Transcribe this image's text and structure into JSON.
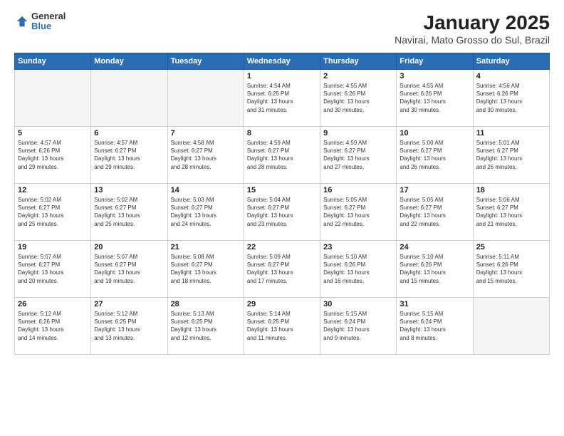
{
  "logo": {
    "general": "General",
    "blue": "Blue"
  },
  "title": "January 2025",
  "subtitle": "Navirai, Mato Grosso do Sul, Brazil",
  "days_of_week": [
    "Sunday",
    "Monday",
    "Tuesday",
    "Wednesday",
    "Thursday",
    "Friday",
    "Saturday"
  ],
  "weeks": [
    [
      {
        "day": "",
        "info": ""
      },
      {
        "day": "",
        "info": ""
      },
      {
        "day": "",
        "info": ""
      },
      {
        "day": "1",
        "info": "Sunrise: 4:54 AM\nSunset: 6:25 PM\nDaylight: 13 hours\nand 31 minutes."
      },
      {
        "day": "2",
        "info": "Sunrise: 4:55 AM\nSunset: 6:26 PM\nDaylight: 13 hours\nand 30 minutes."
      },
      {
        "day": "3",
        "info": "Sunrise: 4:55 AM\nSunset: 6:26 PM\nDaylight: 13 hours\nand 30 minutes."
      },
      {
        "day": "4",
        "info": "Sunrise: 4:56 AM\nSunset: 6:26 PM\nDaylight: 13 hours\nand 30 minutes."
      }
    ],
    [
      {
        "day": "5",
        "info": "Sunrise: 4:57 AM\nSunset: 6:26 PM\nDaylight: 13 hours\nand 29 minutes."
      },
      {
        "day": "6",
        "info": "Sunrise: 4:57 AM\nSunset: 6:27 PM\nDaylight: 13 hours\nand 29 minutes."
      },
      {
        "day": "7",
        "info": "Sunrise: 4:58 AM\nSunset: 6:27 PM\nDaylight: 13 hours\nand 28 minutes."
      },
      {
        "day": "8",
        "info": "Sunrise: 4:59 AM\nSunset: 6:27 PM\nDaylight: 13 hours\nand 28 minutes."
      },
      {
        "day": "9",
        "info": "Sunrise: 4:59 AM\nSunset: 6:27 PM\nDaylight: 13 hours\nand 27 minutes."
      },
      {
        "day": "10",
        "info": "Sunrise: 5:00 AM\nSunset: 6:27 PM\nDaylight: 13 hours\nand 26 minutes."
      },
      {
        "day": "11",
        "info": "Sunrise: 5:01 AM\nSunset: 6:27 PM\nDaylight: 13 hours\nand 26 minutes."
      }
    ],
    [
      {
        "day": "12",
        "info": "Sunrise: 5:02 AM\nSunset: 6:27 PM\nDaylight: 13 hours\nand 25 minutes."
      },
      {
        "day": "13",
        "info": "Sunrise: 5:02 AM\nSunset: 6:27 PM\nDaylight: 13 hours\nand 25 minutes."
      },
      {
        "day": "14",
        "info": "Sunrise: 5:03 AM\nSunset: 6:27 PM\nDaylight: 13 hours\nand 24 minutes."
      },
      {
        "day": "15",
        "info": "Sunrise: 5:04 AM\nSunset: 6:27 PM\nDaylight: 13 hours\nand 23 minutes."
      },
      {
        "day": "16",
        "info": "Sunrise: 5:05 AM\nSunset: 6:27 PM\nDaylight: 13 hours\nand 22 minutes."
      },
      {
        "day": "17",
        "info": "Sunrise: 5:05 AM\nSunset: 6:27 PM\nDaylight: 13 hours\nand 22 minutes."
      },
      {
        "day": "18",
        "info": "Sunrise: 5:06 AM\nSunset: 6:27 PM\nDaylight: 13 hours\nand 21 minutes."
      }
    ],
    [
      {
        "day": "19",
        "info": "Sunrise: 5:07 AM\nSunset: 6:27 PM\nDaylight: 13 hours\nand 20 minutes."
      },
      {
        "day": "20",
        "info": "Sunrise: 5:07 AM\nSunset: 6:27 PM\nDaylight: 13 hours\nand 19 minutes."
      },
      {
        "day": "21",
        "info": "Sunrise: 5:08 AM\nSunset: 6:27 PM\nDaylight: 13 hours\nand 18 minutes."
      },
      {
        "day": "22",
        "info": "Sunrise: 5:09 AM\nSunset: 6:27 PM\nDaylight: 13 hours\nand 17 minutes."
      },
      {
        "day": "23",
        "info": "Sunrise: 5:10 AM\nSunset: 6:26 PM\nDaylight: 13 hours\nand 16 minutes."
      },
      {
        "day": "24",
        "info": "Sunrise: 5:10 AM\nSunset: 6:26 PM\nDaylight: 13 hours\nand 15 minutes."
      },
      {
        "day": "25",
        "info": "Sunrise: 5:11 AM\nSunset: 6:26 PM\nDaylight: 13 hours\nand 15 minutes."
      }
    ],
    [
      {
        "day": "26",
        "info": "Sunrise: 5:12 AM\nSunset: 6:26 PM\nDaylight: 13 hours\nand 14 minutes."
      },
      {
        "day": "27",
        "info": "Sunrise: 5:12 AM\nSunset: 6:25 PM\nDaylight: 13 hours\nand 13 minutes."
      },
      {
        "day": "28",
        "info": "Sunrise: 5:13 AM\nSunset: 6:25 PM\nDaylight: 13 hours\nand 12 minutes."
      },
      {
        "day": "29",
        "info": "Sunrise: 5:14 AM\nSunset: 6:25 PM\nDaylight: 13 hours\nand 11 minutes."
      },
      {
        "day": "30",
        "info": "Sunrise: 5:15 AM\nSunset: 6:24 PM\nDaylight: 13 hours\nand 9 minutes."
      },
      {
        "day": "31",
        "info": "Sunrise: 5:15 AM\nSunset: 6:24 PM\nDaylight: 13 hours\nand 8 minutes."
      },
      {
        "day": "",
        "info": ""
      }
    ]
  ]
}
